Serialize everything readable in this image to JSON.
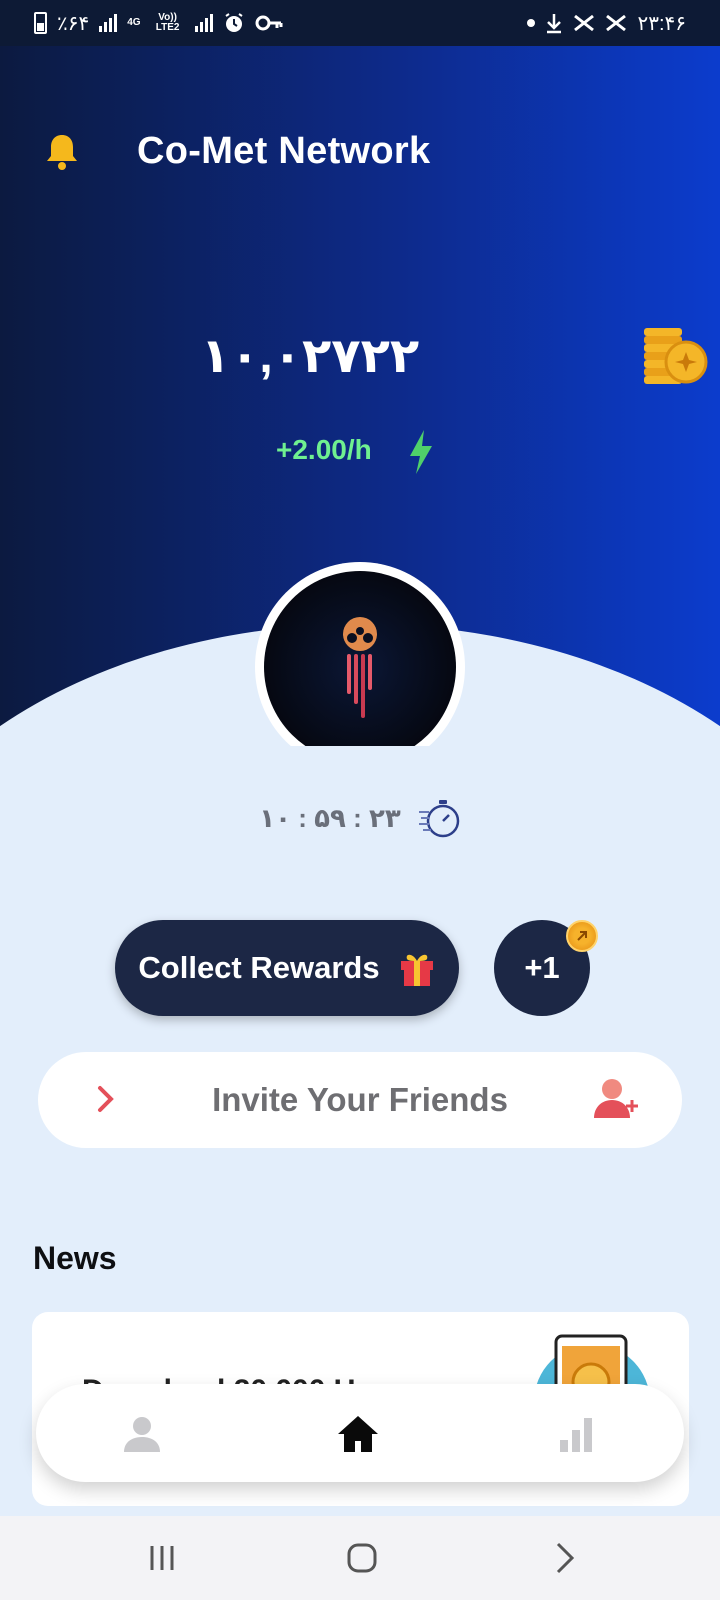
{
  "status_bar": {
    "battery": "٪۶۴",
    "network_4g": "4G",
    "network_volte": "Vo)) LTE2",
    "time": "۲۳:۴۶"
  },
  "header": {
    "title": "Co-Met Network",
    "bell_icon": "bell-icon"
  },
  "balance": {
    "value": "۱۰,۰۲۷۲۲",
    "rate": "+2.00/h",
    "coins_icon": "coin-stack-icon",
    "bolt_icon": "lightning-bolt-icon"
  },
  "mining": {
    "timer": "۱۰ : ۵۹ : ۲۳",
    "stopwatch_icon": "stopwatch-icon"
  },
  "actions": {
    "collect_label": "Collect Rewards",
    "gift_icon": "gift-icon",
    "plus_label": "+1"
  },
  "invite": {
    "label": "Invite Your Friends",
    "chevron_icon": "chevron-right-icon",
    "add_user_icon": "add-user-icon"
  },
  "news": {
    "title": "News",
    "card_text": "Download 20,000 U"
  },
  "bottom_nav": {
    "items": [
      {
        "icon": "profile-icon",
        "active": false
      },
      {
        "icon": "home-icon",
        "active": true
      },
      {
        "icon": "stats-icon",
        "active": false
      }
    ]
  },
  "colors": {
    "hero_dark": "#0c1a40",
    "hero_bright": "#0c3ccd",
    "background": "#e3eefb",
    "rate_green": "#6ff090",
    "button_dark": "#1c2745",
    "invite_text": "#6e6e72"
  }
}
